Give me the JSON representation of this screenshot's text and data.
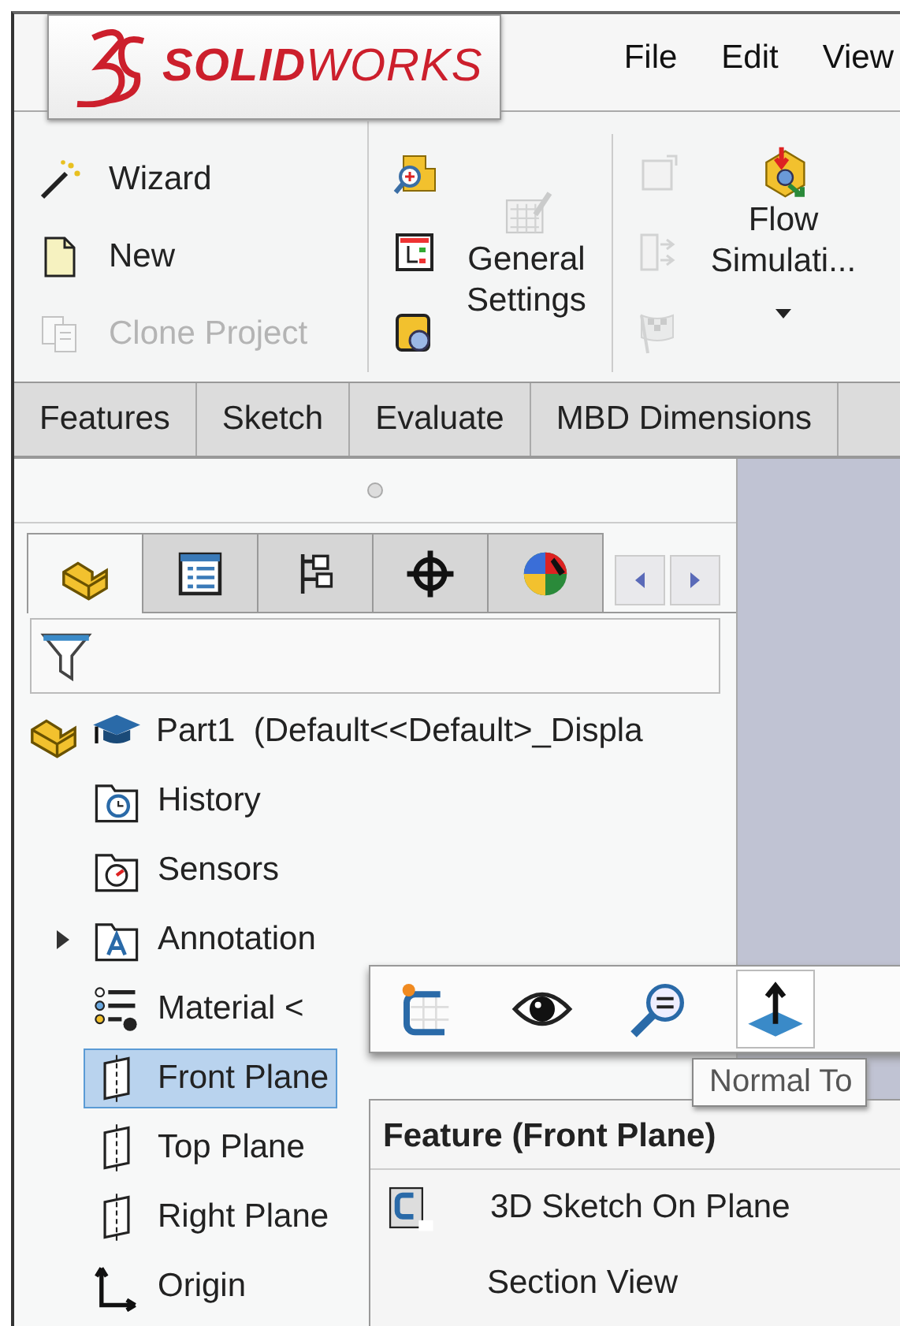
{
  "logo": {
    "brand": "**SOLID**WORKS"
  },
  "menu": [
    "File",
    "Edit",
    "View"
  ],
  "ribbon": {
    "project_items": [
      {
        "label": "Wizard",
        "kind": "wizard",
        "disabled": false
      },
      {
        "label": "New",
        "kind": "new",
        "disabled": false
      },
      {
        "label": "Clone Project",
        "kind": "clone",
        "disabled": true
      }
    ],
    "tool_icons": [
      {
        "kind": "partzoom",
        "disabled": false
      },
      {
        "kind": "treetable",
        "disabled": false
      },
      {
        "kind": "lens",
        "disabled": false
      }
    ],
    "settings": {
      "label": "General Settings",
      "disabled": true
    },
    "sim_icons": [
      {
        "kind": "frame",
        "disabled": true
      },
      {
        "kind": "arrows",
        "disabled": true
      },
      {
        "kind": "flag",
        "disabled": true
      }
    ],
    "flow": {
      "label": "Flow Simulati...",
      "dropdown": true
    }
  },
  "command_tabs": [
    {
      "label": "Features",
      "selected": false
    },
    {
      "label": "Sketch",
      "selected": false
    },
    {
      "label": "Evaluate",
      "selected": false
    },
    {
      "label": "MBD Dimensions",
      "selected": false
    }
  ],
  "panel_tabs": [
    {
      "kind": "part",
      "selected": true
    },
    {
      "kind": "properties",
      "selected": false
    },
    {
      "kind": "configs",
      "selected": false
    },
    {
      "kind": "target",
      "selected": false
    },
    {
      "kind": "appearance",
      "selected": false
    }
  ],
  "tree": {
    "root": {
      "label": "Part1  (Default<<Default>_Displa"
    },
    "items": [
      {
        "label": "History",
        "kind": "history",
        "expander": false,
        "selected": false
      },
      {
        "label": "Sensors",
        "kind": "sensors",
        "expander": false,
        "selected": false
      },
      {
        "label": "Annotation",
        "kind": "annotations",
        "expander": true,
        "selected": false
      },
      {
        "label": "Material <",
        "kind": "material",
        "expander": false,
        "selected": false
      },
      {
        "label": "Front Plane",
        "kind": "plane",
        "expander": false,
        "selected": true
      },
      {
        "label": "Top Plane",
        "kind": "plane",
        "expander": false,
        "selected": false
      },
      {
        "label": "Right Plane",
        "kind": "plane",
        "expander": false,
        "selected": false
      },
      {
        "label": "Origin",
        "kind": "origin",
        "expander": false,
        "selected": false
      }
    ]
  },
  "context_toolbar": {
    "buttons": [
      {
        "kind": "sketch",
        "hovered": false
      },
      {
        "kind": "eye",
        "hovered": false
      },
      {
        "kind": "find",
        "hovered": false
      },
      {
        "kind": "normal",
        "hovered": true
      }
    ]
  },
  "tooltip": {
    "text": "Normal To"
  },
  "context_menu": {
    "title": "Feature (Front Plane)",
    "items": [
      {
        "label": "3D Sketch On Plane",
        "kind": "sketch3d"
      },
      {
        "label": "Section View",
        "kind": "plain"
      }
    ]
  }
}
